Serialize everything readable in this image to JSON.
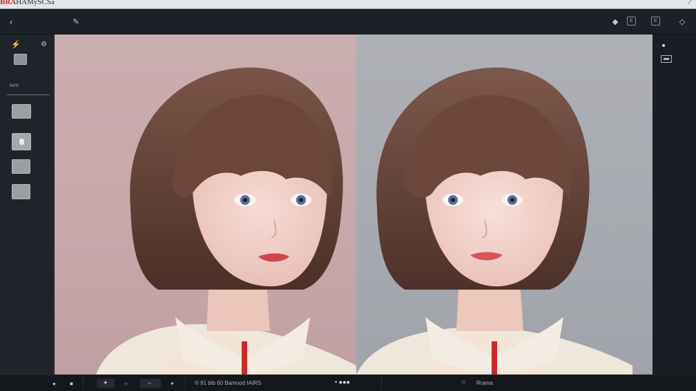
{
  "app": {
    "brand_mark": "BRA",
    "brand_name": "HAMySCSa"
  },
  "toolbar": {
    "left": [
      {
        "icon": "chevron-left-icon",
        "glyph": "‹"
      },
      {
        "icon": "brush-icon",
        "glyph": "✎"
      }
    ],
    "right": [
      {
        "icon": "diamond-icon",
        "glyph": "◆"
      },
      {
        "icon": "layer-icon",
        "glyph": "E"
      },
      {
        "icon": "frame-icon",
        "glyph": "E"
      },
      {
        "icon": "drop-icon",
        "glyph": "◇"
      }
    ]
  },
  "left_panel": {
    "top_icons": [
      {
        "icon": "wand-icon",
        "glyph": "⚡"
      },
      {
        "icon": "settings-icon",
        "glyph": "⚙"
      }
    ],
    "section_label": "Ivrri",
    "thumbnails": 5
  },
  "canvas": {
    "panes": [
      {
        "name": "original",
        "background": "#c7a8aa"
      },
      {
        "name": "result",
        "background": "#a8aab0"
      }
    ]
  },
  "statusbar": {
    "tools": [
      {
        "icon": "circle-filled-icon",
        "glyph": "●"
      },
      {
        "icon": "stop-icon",
        "glyph": "■"
      },
      {
        "icon": "sparkle-icon",
        "glyph": "✦"
      },
      {
        "icon": "ring-icon",
        "glyph": "○"
      },
      {
        "icon": "dash-icon",
        "glyph": "–"
      },
      {
        "icon": "star-icon",
        "glyph": "✦"
      }
    ],
    "info_text": "© 91 bib 60  Bamood  IAIRS",
    "dots": "• ●●●",
    "mode_icon": "○",
    "mode_label": "Rrama"
  },
  "colors": {
    "background": "#15181d",
    "toolbar": "#1c2027",
    "panel": "#1f232a",
    "accent_red": "#c8292b"
  }
}
